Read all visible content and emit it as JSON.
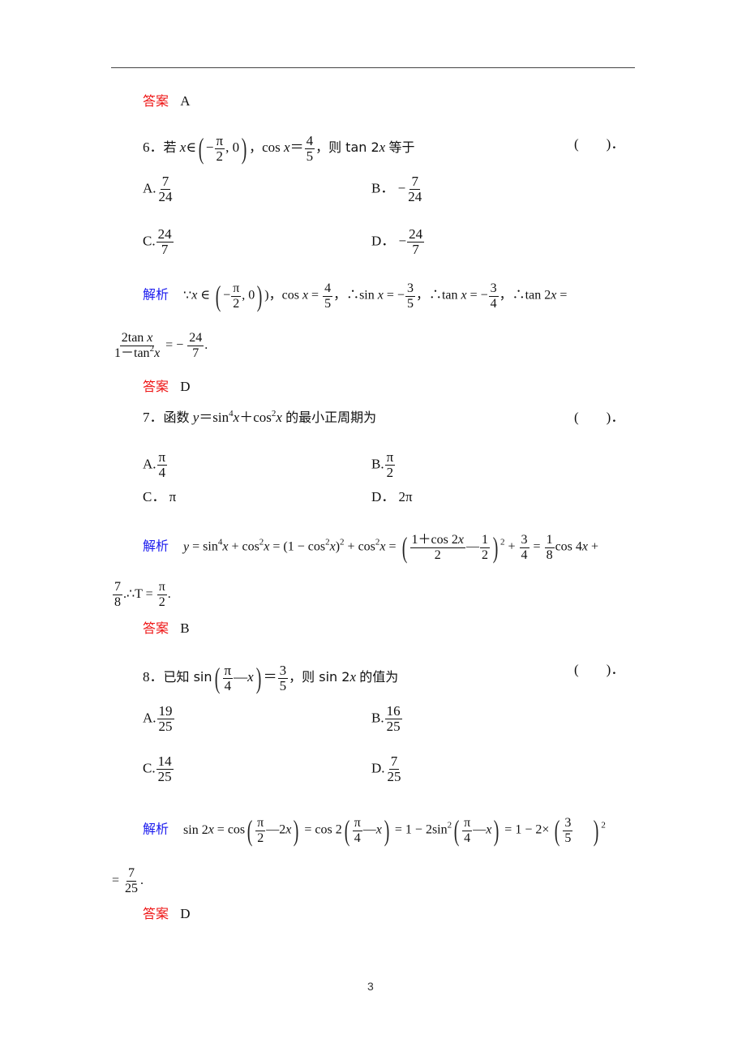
{
  "page_number": "3",
  "labels": {
    "answer": "答案",
    "analysis": "解析"
  },
  "answer_prev": "A",
  "q6": {
    "number": "6．",
    "pre": "若",
    "x": "x",
    "in": "∈",
    "minus": "−",
    "pi": "π",
    "two": "2",
    "zero": "0",
    "comma": "，",
    "cos": "cos",
    "eq": "＝",
    "four": "4",
    "five": "5",
    "then": "，则 tan 2",
    "tail": "等于",
    "bracket": "(　　)．",
    "options": [
      {
        "label": "A.",
        "sign": "",
        "num": "7",
        "den": "24"
      },
      {
        "label": "B．",
        "sign": "−",
        "num": "7",
        "den": "24"
      },
      {
        "label": "C.",
        "sign": "",
        "num": "24",
        "den": "7"
      },
      {
        "label": "D．",
        "sign": "−",
        "num": "24",
        "den": "7"
      }
    ],
    "analysis": {
      "because": "∵",
      "p1": ")，cos ",
      "p2": "，∴sin ",
      "p3": "，∴tan ",
      "p4": "，∴tan 2",
      "eq": " = ",
      "neg": " −",
      "f_cos": {
        "num": "4",
        "den": "5"
      },
      "f_sin": {
        "num": "3",
        "den": "5"
      },
      "f_tan": {
        "num": "3",
        "den": "4"
      },
      "line2_num": "2tan ",
      "line2_den": "1－tan",
      "result": {
        "num": "24",
        "den": "7"
      },
      "period": "."
    },
    "answer": "D"
  },
  "q7": {
    "number": "7．",
    "pre": "函数",
    "expr": "＝sin",
    "plus": "＋cos",
    "tail": "的最小正周期为",
    "bracket": "(　　)．",
    "options": [
      {
        "label": "A.",
        "num": "π",
        "den": "4"
      },
      {
        "label": "B.",
        "num": "π",
        "den": "2"
      },
      {
        "label": "C．",
        "text": "π"
      },
      {
        "label": "D．",
        "text": "2π"
      }
    ],
    "analysis": {
      "seg1": " = sin",
      "seg2": " + cos",
      "seg3": " = (1 − cos",
      "seg4": ")",
      "seg5": " + cos",
      "seg6": " = ",
      "big_num": "1＋cos 2",
      "big_den": "2",
      "half": {
        "num": "1",
        "den": "2"
      },
      "seg7": " + ",
      "tq": {
        "num": "3",
        "den": "4"
      },
      "eight": {
        "num": "1",
        "den": "8"
      },
      "seg8": "cos 4",
      "seg9": " +",
      "line2_f": {
        "num": "7",
        "den": "8"
      },
      "line2_mid": ".∴T = ",
      "line2_res": {
        "num": "π",
        "den": "2"
      },
      "period": "."
    },
    "answer": "B"
  },
  "q8": {
    "number": "8．",
    "pre": "已知 sin",
    "mid": "＝",
    "then": "，则 sin 2",
    "tail": "的值为",
    "bracket": "(　　)．",
    "pi4": {
      "num": "π",
      "den": "4"
    },
    "rhs": {
      "num": "3",
      "den": "5"
    },
    "options": [
      {
        "label": "A.",
        "num": "19",
        "den": "25"
      },
      {
        "label": "B.",
        "num": "16",
        "den": "25"
      },
      {
        "label": "C.",
        "num": "14",
        "den": "25"
      },
      {
        "label": "D.",
        "num": "7",
        "den": "25"
      }
    ],
    "analysis": {
      "seg1": "sin 2",
      "seg2": " = cos",
      "seg3": " = cos 2",
      "seg4": " = 1 − 2sin",
      "seg5": " = 1 − 2×",
      "pi2": {
        "num": "π",
        "den": "2"
      },
      "pi4": {
        "num": "π",
        "den": "4"
      },
      "tf": {
        "num": "3",
        "den": "5"
      },
      "minus2x": "—2",
      "minusx": "—",
      "line2_eq": "= ",
      "result": {
        "num": "7",
        "den": "25"
      },
      "period": "."
    },
    "answer": "D"
  }
}
